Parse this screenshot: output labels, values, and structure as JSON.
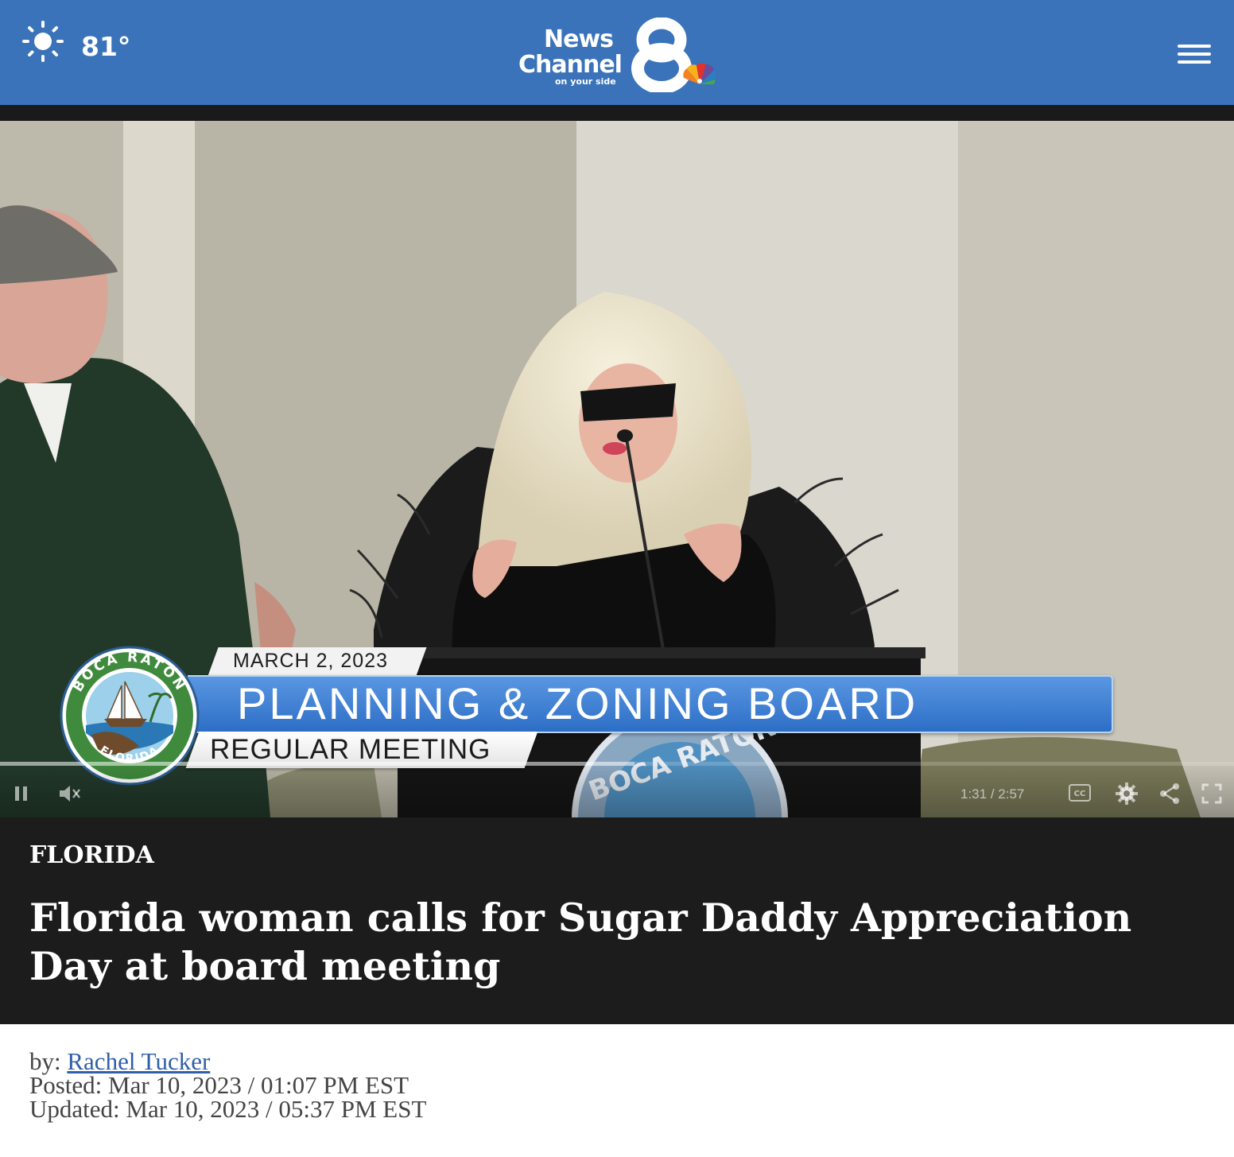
{
  "header": {
    "temperature": "81°",
    "weather_icon": "sun-icon",
    "logo": {
      "news": "News",
      "channel": "Channel",
      "tagline": "on your side",
      "number": "8"
    },
    "menu_icon": "hamburger-menu-icon",
    "colors": {
      "header_bg": "#3a73ba"
    }
  },
  "video": {
    "lower_third": {
      "date": "MARCH 2, 2023",
      "title": "PLANNING & ZONING BOARD",
      "subtitle": "REGULAR MEETING",
      "seal_top": "BOCA RATON",
      "seal_bottom": "FLORIDA",
      "colors": {
        "banner": "#2d6ec6"
      }
    },
    "podium_seal_text": "BOCA RATON",
    "player": {
      "current_time": "1:31",
      "duration": "2:57",
      "progress_fraction": 0.514,
      "buttons": [
        "pause-icon",
        "mute-icon",
        "closed-captions-icon",
        "gear-icon",
        "share-icon",
        "fullscreen-icon"
      ],
      "cc_label": "CC"
    }
  },
  "article": {
    "category": "FLORIDA",
    "title": "Florida woman calls for Sugar Daddy Appreciation Day at board meeting",
    "byline_prefix": "by:",
    "author": "Rachel Tucker",
    "posted": "Posted: Mar 10, 2023 / 01:07 PM EST",
    "updated": "Updated: Mar 10, 2023 / 05:37 PM EST"
  }
}
